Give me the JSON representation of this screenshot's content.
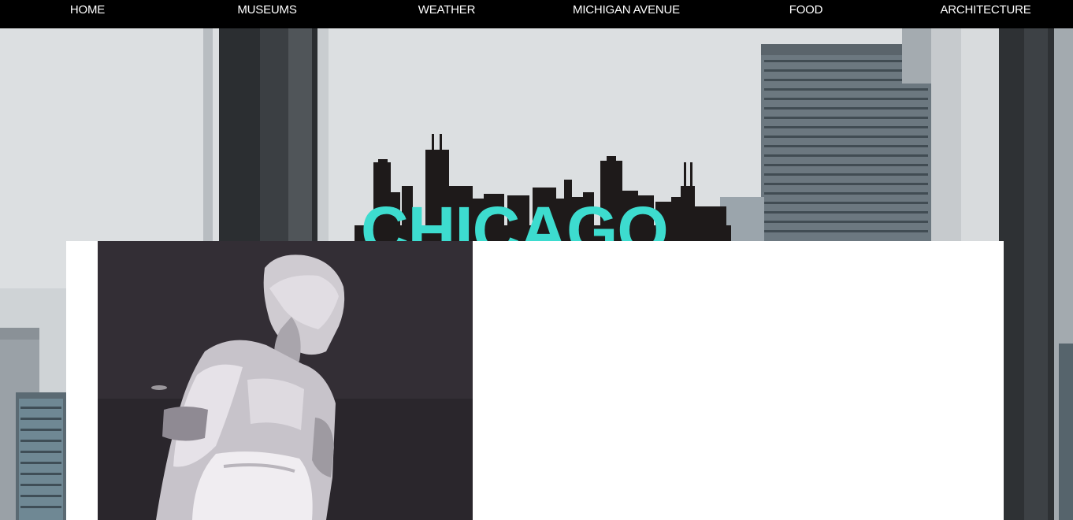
{
  "nav": {
    "items": [
      {
        "label": "HOME"
      },
      {
        "label": "MUSEUMS"
      },
      {
        "label": "WEATHER"
      },
      {
        "label": "MICHIGAN AVENUE"
      },
      {
        "label": "FOOD"
      },
      {
        "label": "ARCHITECTURE"
      }
    ]
  },
  "hero": {
    "logo_text": "CHICAGO"
  },
  "colors": {
    "nav_background": "#000000",
    "nav_text": "#ffffff",
    "logo_accent": "#3ddccf",
    "skyline": "#1e1a1a",
    "card_background": "#ffffff"
  }
}
